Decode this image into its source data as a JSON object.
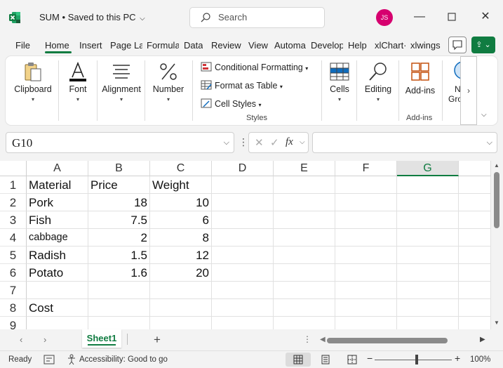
{
  "window": {
    "title": "SUM",
    "save_status": "Saved to this PC",
    "search_placeholder": "Search",
    "avatar_initials": "JS"
  },
  "menu": {
    "items": [
      "File",
      "Home",
      "Insert",
      "Page La",
      "Formula",
      "Data",
      "Review",
      "View",
      "Automa",
      "Develop",
      "Help",
      "xlChart·",
      "xlwings"
    ],
    "active": "Home"
  },
  "ribbon": {
    "clipboard": "Clipboard",
    "font": "Font",
    "alignment": "Alignment",
    "number": "Number",
    "conditional_formatting": "Conditional Formatting",
    "format_as_table": "Format as Table",
    "cell_styles": "Cell Styles",
    "styles_group": "Styles",
    "cells": "Cells",
    "editing": "Editing",
    "addins": "Add-ins",
    "addins_group": "Add-ins",
    "new_group_line1": "N",
    "new_group_line2": "Gro"
  },
  "formula_bar": {
    "name_box": "G10",
    "fx": "fx",
    "formula": ""
  },
  "grid": {
    "columns": [
      "A",
      "B",
      "C",
      "D",
      "E",
      "F",
      "G"
    ],
    "selected_column": "G",
    "rows": [
      {
        "n": "1",
        "a": "Material",
        "b": "Price",
        "c": "Weight"
      },
      {
        "n": "2",
        "a": "Pork",
        "b": "18",
        "c": "10"
      },
      {
        "n": "3",
        "a": "Fish",
        "b": "7.5",
        "c": "6"
      },
      {
        "n": "4",
        "a": "cabbage",
        "b": "2",
        "c": "8"
      },
      {
        "n": "5",
        "a": "Radish",
        "b": "1.5",
        "c": "12"
      },
      {
        "n": "6",
        "a": "Potato",
        "b": "1.6",
        "c": "20"
      },
      {
        "n": "7",
        "a": "",
        "b": "",
        "c": ""
      },
      {
        "n": "8",
        "a": "Cost",
        "b": "",
        "c": ""
      },
      {
        "n": "9",
        "a": "",
        "b": "",
        "c": ""
      }
    ]
  },
  "sheets": {
    "active": "Sheet1",
    "add_label": "+"
  },
  "status": {
    "ready": "Ready",
    "accessibility": "Accessibility: Good to go",
    "zoom": "100%",
    "zoom_minus": "−",
    "zoom_plus": "+"
  },
  "colors": {
    "accent": "#107c41",
    "avatar": "#d6006f"
  }
}
